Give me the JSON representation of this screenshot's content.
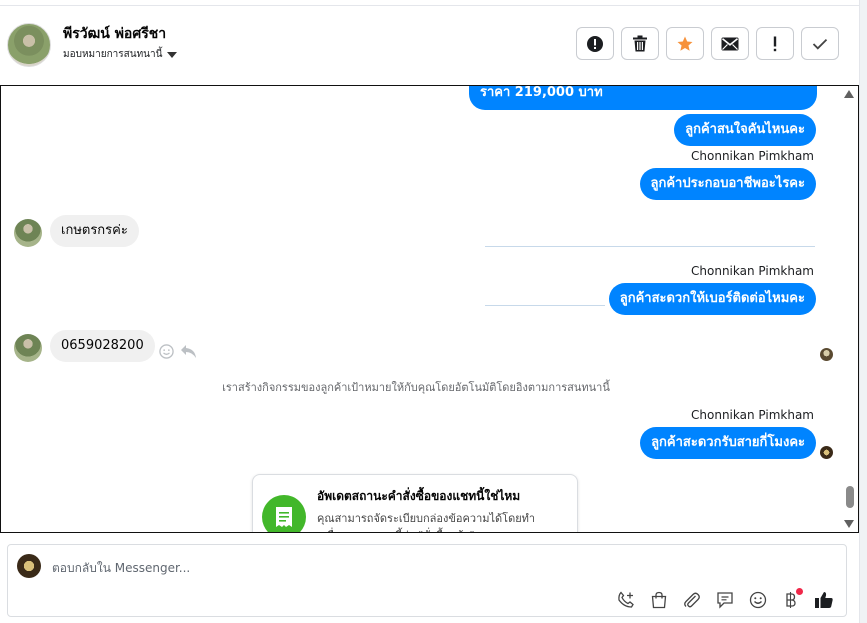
{
  "header": {
    "contact_name": "พีรวัฒน์ พ่อศรีชา",
    "assign_label": "มอบหมายการสนทนานี้",
    "actions": [
      {
        "name": "spam-button",
        "icon": "alert-circle-icon"
      },
      {
        "name": "delete-button",
        "icon": "trash-icon"
      },
      {
        "name": "star-button",
        "icon": "star-icon"
      },
      {
        "name": "mark-unread-button",
        "icon": "envelope-icon"
      },
      {
        "name": "important-button",
        "icon": "exclamation-icon"
      },
      {
        "name": "done-button",
        "icon": "check-icon"
      }
    ]
  },
  "messages": {
    "m1": "ราคา 219,000 บาท",
    "m2": "ลูกค้าสนใจคันไหนคะ",
    "sender1": "Chonnikan Pimkham",
    "m3": "ลูกค้าประกอบอาชีพอะไรคะ",
    "m4": "เกษตรกรค่ะ",
    "sender2": "Chonnikan Pimkham",
    "m5": "ลูกค้าสะดวกให้เบอร์ติดต่อไหมคะ",
    "m6": "0659028200",
    "system_note": "เราสร้างกิจกรรมของลูกค้าเป้าหมายให้กับคุณโดยอัตโนมัติโดยอิงตามการสนทนานี้",
    "sender3": "Chonnikan Pimkham",
    "m7": "ลูกค้าสะดวกรับสายกี่โมงคะ"
  },
  "card": {
    "title": "อัพเดตสถานะคำสั่งซื้อของแชทนี้ใช่ไหม",
    "desc": "คุณสามารถจัดระเบียบกล่องข้อความได้โดยทำเครื่องหมายแชทนี้ว่า \"สั่งซื้อแล้ว\""
  },
  "composer": {
    "placeholder": "ตอบกลับใน Messenger...",
    "tools": [
      "call-add-icon",
      "shopping-bag-icon",
      "paperclip-icon",
      "saved-reply-icon",
      "emoji-icon",
      "baht-icon",
      "thumbs-up-icon"
    ]
  },
  "colors": {
    "bubble_out": "#0084ff",
    "bubble_in": "#f0f0f0",
    "star": "#f7923b",
    "card_icon": "#42b72a",
    "notification_dot": "#f02849"
  }
}
